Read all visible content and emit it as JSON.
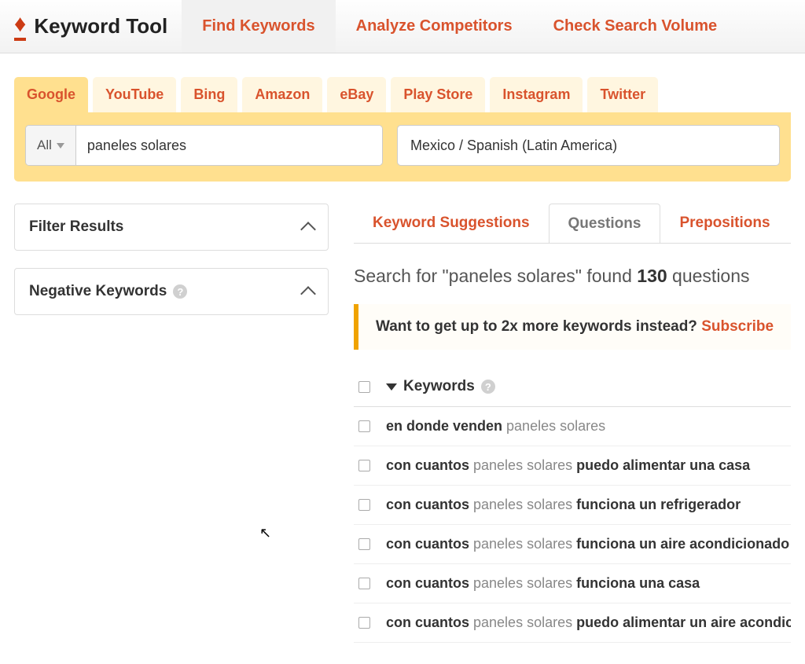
{
  "brand": {
    "name": "Keyword Tool"
  },
  "topnav": {
    "items": [
      "Find Keywords",
      "Analyze Competitors",
      "Check Search Volume"
    ],
    "active_index": 0
  },
  "engine_tabs": {
    "items": [
      "Google",
      "YouTube",
      "Bing",
      "Amazon",
      "eBay",
      "Play Store",
      "Instagram",
      "Twitter"
    ],
    "active_index": 0
  },
  "search": {
    "scope_label": "All",
    "query": "paneles solares",
    "region": "Mexico / Spanish (Latin America)"
  },
  "sidebar": {
    "filter_results": "Filter Results",
    "negative_keywords": "Negative Keywords"
  },
  "result_tabs": {
    "items": [
      "Keyword Suggestions",
      "Questions",
      "Prepositions"
    ],
    "active_index": 1
  },
  "result_heading": {
    "pre": "Search for \"",
    "query": "paneles solares",
    "mid": "\" found ",
    "count": "130",
    "post": " questions"
  },
  "promo": {
    "text": "Want to get up to 2x more keywords instead? ",
    "cta": "Subscribe"
  },
  "table": {
    "header": "Keywords",
    "query_term": "paneles solares",
    "rows": [
      {
        "prefix": "en donde venden",
        "suffix": ""
      },
      {
        "prefix": "con cuantos",
        "suffix": "puedo alimentar una casa"
      },
      {
        "prefix": "con cuantos",
        "suffix": "funciona un refrigerador"
      },
      {
        "prefix": "con cuantos",
        "suffix": "funciona un aire acondicionado"
      },
      {
        "prefix": "con cuantos",
        "suffix": "funciona una casa"
      },
      {
        "prefix": "con cuantos",
        "suffix": "puedo alimentar un aire acondicionado"
      }
    ]
  }
}
